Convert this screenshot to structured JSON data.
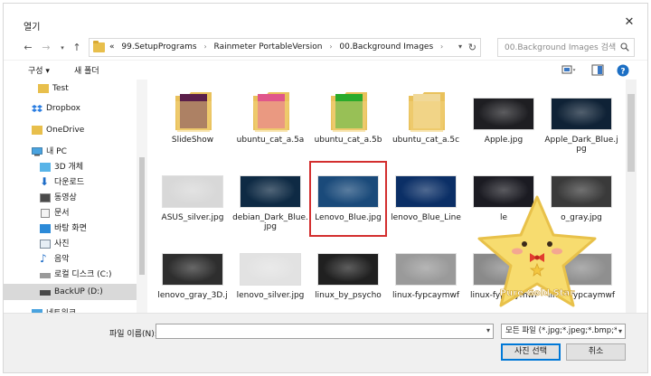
{
  "window": {
    "title": "열기"
  },
  "address": {
    "crumbs": [
      "«",
      "99.SetupPrograms",
      "›",
      "Rainmeter PortableVersion",
      "›",
      "00.Background Images",
      "›"
    ]
  },
  "search": {
    "placeholder": "00.Background Images 검색"
  },
  "toolbar": {
    "organize": "구성 ▾",
    "new_folder": "새 폴더"
  },
  "nav": {
    "items": [
      {
        "label": "Test",
        "icon": "folder-icon"
      },
      {
        "label": "Dropbox",
        "icon": "dropbox-icon"
      },
      {
        "label": "OneDrive",
        "icon": "folder-icon"
      },
      {
        "label": "내 PC",
        "icon": "pc-icon"
      },
      {
        "label": "3D 개체",
        "icon": "cube-icon"
      },
      {
        "label": "다운로드",
        "icon": "download-icon"
      },
      {
        "label": "동영상",
        "icon": "video-icon"
      },
      {
        "label": "문서",
        "icon": "document-icon"
      },
      {
        "label": "바탕 화면",
        "icon": "desktop-icon"
      },
      {
        "label": "사진",
        "icon": "picture-icon"
      },
      {
        "label": "음악",
        "icon": "music-icon"
      },
      {
        "label": "로컬 디스크 (C:)",
        "icon": "drive-icon"
      },
      {
        "label": "BackUP (D:)",
        "icon": "drive-icon"
      },
      {
        "label": "네트워크",
        "icon": "network-icon"
      }
    ]
  },
  "files": [
    {
      "name": "SlideShow",
      "kind": "folder",
      "color": "#5a1f4a"
    },
    {
      "name": "ubuntu_cat_a.5a",
      "kind": "folder",
      "color": "#e0568a"
    },
    {
      "name": "ubuntu_cat_a.5b",
      "kind": "folder",
      "color": "#2aaa2a"
    },
    {
      "name": "ubuntu_cat_a.5c",
      "kind": "folder",
      "color": "#f0d898"
    },
    {
      "name": "Apple.jpg",
      "kind": "image",
      "color": "#1e1e22"
    },
    {
      "name": "Apple_Dark_Blue.jpg",
      "kind": "image",
      "color": "#0f2236"
    },
    {
      "name": "ASUS_silver.jpg",
      "kind": "image",
      "color": "#d8d8d8"
    },
    {
      "name": "debian_Dark_Blue.jpg",
      "kind": "image",
      "color": "#0e2a44"
    },
    {
      "name": "Lenovo_Blue.jpg",
      "kind": "image",
      "color": "#1a4a7a"
    },
    {
      "name": "lenovo_Blue_Line",
      "kind": "image",
      "color": "#0b2f66"
    },
    {
      "name": "le",
      "kind": "image",
      "color": "#1b1b22"
    },
    {
      "name": "o_gray.jpg",
      "kind": "image",
      "color": "#3a3a3a"
    },
    {
      "name": "lenovo_gray_3D.j",
      "kind": "image",
      "color": "#2e2e2e"
    },
    {
      "name": "lenovo_silver.jpg",
      "kind": "image",
      "color": "#e2e2e2"
    },
    {
      "name": "linux_by_psycho",
      "kind": "image",
      "color": "#202020"
    },
    {
      "name": "linux-fypcaymwf",
      "kind": "image",
      "color": "#9a9a9a"
    },
    {
      "name": "linux-fypcaymwf",
      "kind": "image",
      "color": "#8a8a8a"
    },
    {
      "name": "linux-fypcaymwf",
      "kind": "image",
      "color": "#8f8f8f"
    }
  ],
  "bottom": {
    "filename_label": "파일 이름(N):",
    "filename_value": "",
    "filter": "모든 파일 (*.jpg;*.jpeg;*.bmp;*.i",
    "open_label": "사진 선택",
    "cancel_label": "취소"
  },
  "sticker": {
    "text": "Pure Gold Star"
  }
}
